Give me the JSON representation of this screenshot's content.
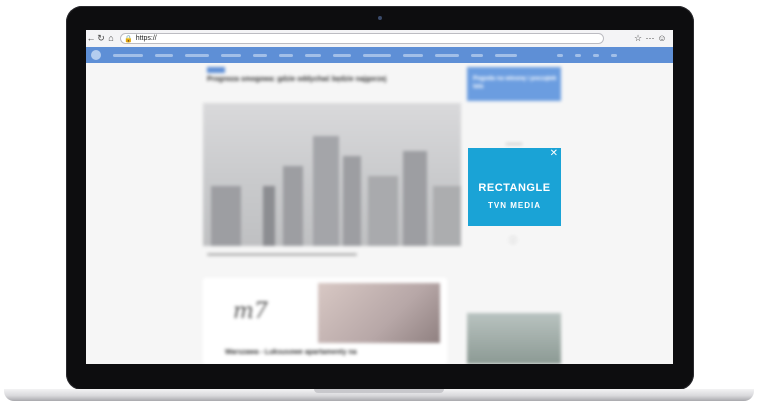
{
  "browser": {
    "url": "https://",
    "back_icon": "arrow-left-icon",
    "reload_icon": "reload-icon",
    "home_icon": "home-icon"
  },
  "article": {
    "headline": "Prognoza smogowa: gdzie oddychać będzie najgorzej",
    "ad_logo": "m7",
    "ad_title": "Warszawa - Luksusowe apartamenty na"
  },
  "sidebar": {
    "promo_text": "Pogoda na wiosnę i początek lata"
  },
  "ad": {
    "line1": "RECTANGLE",
    "line2": "TVN MEDIA",
    "close": "✕"
  },
  "colors": {
    "nav_blue": "#5e8fd6",
    "ad_blue": "#1aa3d6"
  }
}
